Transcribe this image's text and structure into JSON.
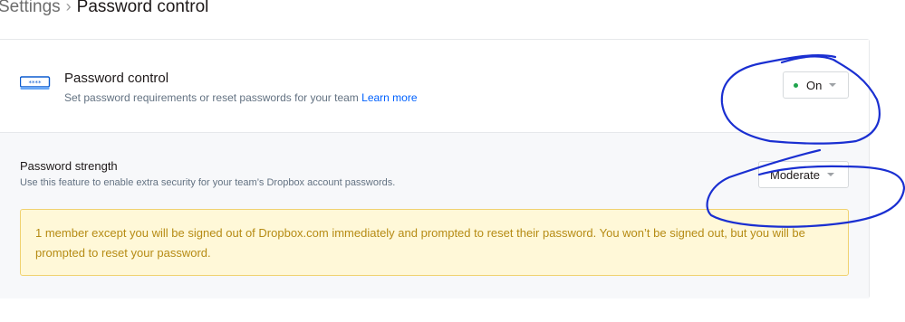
{
  "breadcrumb": {
    "parent": "Settings",
    "separator": "›",
    "current": "Password control"
  },
  "password_control": {
    "icon": "password-dots-icon",
    "title": "Password control",
    "description": "Set password requirements or reset passwords for your team",
    "learn_more": "Learn more",
    "status_value": "On",
    "status_color": "#1fa44c"
  },
  "password_strength": {
    "title": "Password strength",
    "description": "Use this feature to enable extra security for your team’s Dropbox account passwords.",
    "selected_value": "Moderate"
  },
  "warning": {
    "message": "1 member except you will be signed out of Dropbox.com immediately and prompted to reset their password. You won’t be signed out, but you will be prompted to reset your password."
  },
  "colors": {
    "link": "#0061fe",
    "warning_text": "#b68b14",
    "warning_bg": "#fff8d8",
    "annotation_ink": "#1a2fd1"
  }
}
